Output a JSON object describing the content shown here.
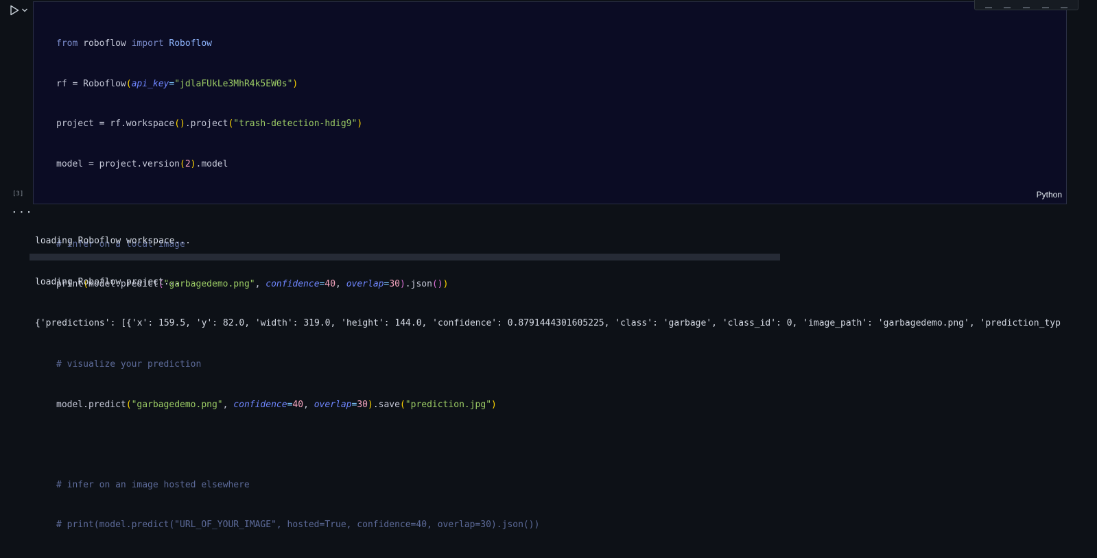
{
  "cell": {
    "execution_count": "[3]",
    "language": "Python",
    "run_icon": "play-icon",
    "run_menu_icon": "chevron-down-icon",
    "code": {
      "l1_a": "from",
      "l1_b": "roboflow",
      "l1_c": "import",
      "l1_d": "Roboflow",
      "l2_a": "rf = Roboflow",
      "l2_b": "(",
      "l2_c": "api_key",
      "l2_d": "=",
      "l2_e": "\"jdlaFUkLe3MhR4k5EW0s\"",
      "l2_f": ")",
      "l3_a": "project = rf.workspace",
      "l3_b": "()",
      "l3_c": ".project",
      "l3_d": "(",
      "l3_e": "\"trash-detection-hdig9\"",
      "l3_f": ")",
      "l4_a": "model = project.version",
      "l4_b": "(",
      "l4_c": "2",
      "l4_d": ")",
      "l4_e": ".model",
      "l6": "# infer on a local image",
      "l7_a": "print",
      "l7_b": "(",
      "l7_c": "model.predict",
      "l7_d": "(",
      "l7_e": "\"garbagedemo.png\"",
      "l7_f": ", ",
      "l7_g": "confidence",
      "l7_h": "=",
      "l7_i": "40",
      "l7_j": ", ",
      "l7_k": "overlap",
      "l7_l": "=",
      "l7_m": "30",
      "l7_n": ")",
      "l7_o": ".json",
      "l7_p": "()",
      "l7_q": ")",
      "l9": "# visualize your prediction",
      "l10_a": "model.predict",
      "l10_b": "(",
      "l10_c": "\"garbagedemo.png\"",
      "l10_d": ", ",
      "l10_e": "confidence",
      "l10_f": "=",
      "l10_g": "40",
      "l10_h": ", ",
      "l10_i": "overlap",
      "l10_j": "=",
      "l10_k": "30",
      "l10_l": ")",
      "l10_m": ".save",
      "l10_n": "(",
      "l10_o": "\"prediction.jpg\"",
      "l10_p": ")",
      "l12": "# infer on an image hosted elsewhere",
      "l13": "# print(model.predict(\"URL_OF_YOUR_IMAGE\", hosted=True, confidence=40, overlap=30).json())"
    }
  },
  "output": {
    "more_label": "···",
    "lines": [
      "loading Roboflow workspace...",
      "loading Roboflow project...",
      "{'predictions': [{'x': 159.5, 'y': 82.0, 'width': 319.0, 'height': 144.0, 'confidence': 0.8791444301605225, 'class': 'garbage', 'class_id': 0, 'image_path': 'garbagedemo.png', 'prediction_typ"
    ]
  }
}
